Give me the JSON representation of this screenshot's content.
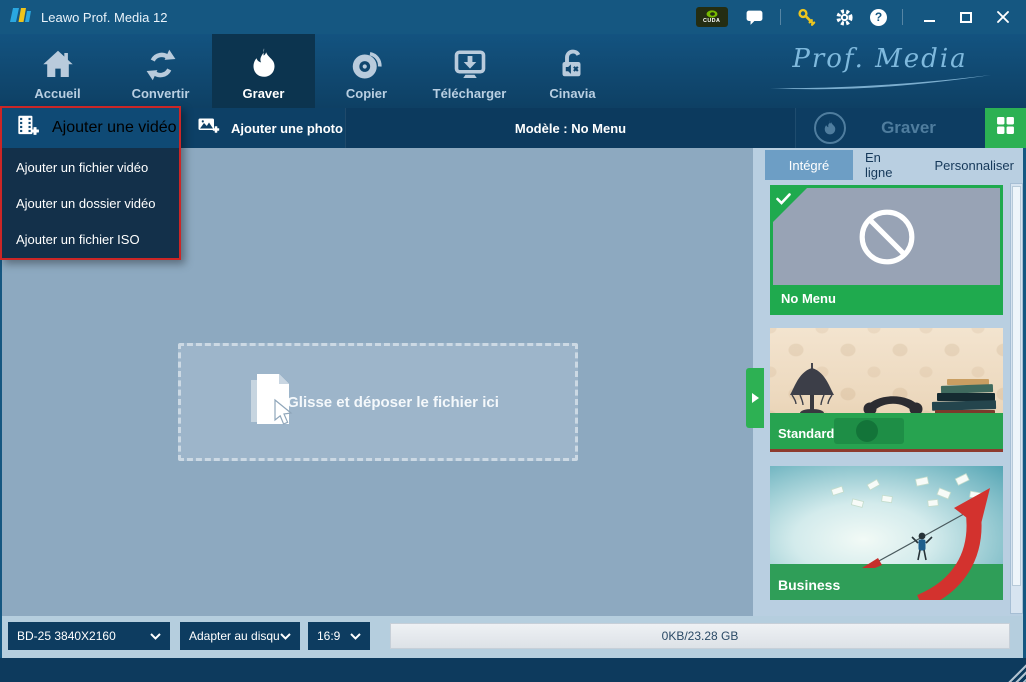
{
  "titlebar": {
    "title": "Leawo Prof. Media 12",
    "cuda_label": "CUDA",
    "help_glyph": "?"
  },
  "nav": {
    "brand": "Prof. Media",
    "tabs": [
      {
        "label": "Accueil",
        "icon": "home-icon"
      },
      {
        "label": "Convertir",
        "icon": "convert-icon"
      },
      {
        "label": "Graver",
        "icon": "burn-flame-icon",
        "active": true
      },
      {
        "label": "Copier",
        "icon": "copy-disc-icon"
      },
      {
        "label": "Télécharger",
        "icon": "download-icon"
      },
      {
        "label": "Cinavia",
        "icon": "cinavia-unlock-icon"
      }
    ]
  },
  "toolbar": {
    "add_video_label": "Ajouter une vidéo",
    "add_photo_label": "Ajouter une photo",
    "template_label": "Modèle : No Menu",
    "burn_label": "Graver"
  },
  "add_video_menu": {
    "items": [
      {
        "label": "Ajouter un fichier vidéo"
      },
      {
        "label": "Ajouter un dossier vidéo"
      },
      {
        "label": "Ajouter un fichier ISO"
      }
    ]
  },
  "main": {
    "dropzone_text": "Glisse et déposer le fichier ici"
  },
  "panel": {
    "tabs": [
      {
        "label": "Intégré",
        "active": true
      },
      {
        "label": "En ligne"
      },
      {
        "label": "Personnaliser"
      }
    ],
    "templates": [
      {
        "name": "No Menu",
        "selected": true
      },
      {
        "name": "Standard"
      },
      {
        "name": "Business"
      }
    ]
  },
  "bottombar": {
    "disc_format": "BD-25 3840X2160",
    "fit_mode": "Adapter au disqu",
    "aspect_ratio": "16:9",
    "capacity": "0KB/23.28 GB"
  },
  "colors": {
    "titlebar_blue": "#155781",
    "navy_dark": "#0d3c5e",
    "accent_green": "#21ab4f",
    "selection_red": "#cc2626",
    "main_bg": "#8da9c0",
    "panel_bg": "#b9cfe1"
  }
}
